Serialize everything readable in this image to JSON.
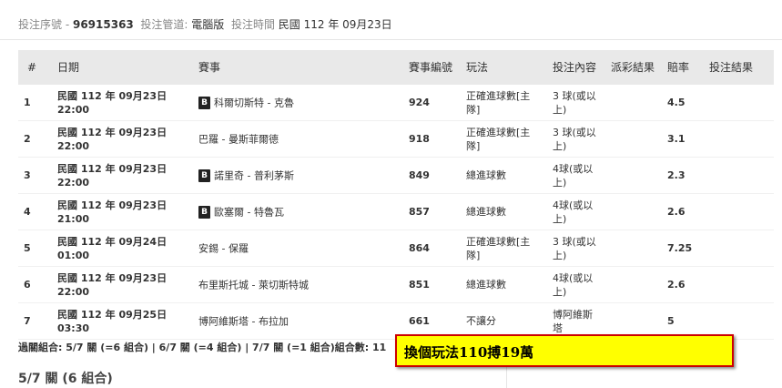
{
  "header": {
    "serial_label": "投注序號 -",
    "serial_value": "96915363",
    "channel_label": "投注管道:",
    "channel_value": "電腦版",
    "time_label": "投注時間",
    "time_value": "民國 112 年 09月23日"
  },
  "table": {
    "columns": [
      "#",
      "日期",
      "賽事",
      "賽事編號",
      "玩法",
      "投注內容",
      "派彩結果",
      "賠率",
      "投注結果"
    ],
    "rows": [
      {
        "idx": "1",
        "date_line1": "民國 112 年 09月23日",
        "date_line2": "22:00",
        "badge": "B",
        "match": "科爾切斯特 - 克魯",
        "no": "924",
        "play": "正確進球數[主隊]",
        "content": "3 球(或以上)",
        "payout": "",
        "odds": "4.5",
        "result": ""
      },
      {
        "idx": "2",
        "date_line1": "民國 112 年 09月23日",
        "date_line2": "22:00",
        "badge": "",
        "match": "巴羅 - 曼斯菲爾德",
        "no": "918",
        "play": "正確進球數[主隊]",
        "content": "3 球(或以上)",
        "payout": "",
        "odds": "3.1",
        "result": ""
      },
      {
        "idx": "3",
        "date_line1": "民國 112 年 09月23日",
        "date_line2": "22:00",
        "badge": "B",
        "match": "諾里奇 - 普利茅斯",
        "no": "849",
        "play": "總進球數",
        "content": "4球(或以上)",
        "payout": "",
        "odds": "2.3",
        "result": ""
      },
      {
        "idx": "4",
        "date_line1": "民國 112 年 09月23日",
        "date_line2": "21:00",
        "badge": "B",
        "match": "歐塞爾 - 特魯瓦",
        "no": "857",
        "play": "總進球數",
        "content": "4球(或以上)",
        "payout": "",
        "odds": "2.6",
        "result": ""
      },
      {
        "idx": "5",
        "date_line1": "民國 112 年 09月24日",
        "date_line2": "01:00",
        "badge": "",
        "match": "安錫 - 保羅",
        "no": "864",
        "play": "正確進球數[主隊]",
        "content": "3 球(或以上)",
        "payout": "",
        "odds": "7.25",
        "result": ""
      },
      {
        "idx": "6",
        "date_line1": "民國 112 年 09月23日",
        "date_line2": "22:00",
        "badge": "",
        "match": "布里斯托城 - 萊切斯特城",
        "no": "851",
        "play": "總進球數",
        "content": "4球(或以上)",
        "payout": "",
        "odds": "2.6",
        "result": ""
      },
      {
        "idx": "7",
        "date_line1": "民國 112 年 09月25日",
        "date_line2": "03:30",
        "badge": "",
        "match": "博阿維斯塔 - 布拉加",
        "no": "661",
        "play": "不讓分",
        "content": "博阿維斯塔",
        "payout": "",
        "odds": "5",
        "result": ""
      }
    ]
  },
  "summary": {
    "combo_text": "過關組合: 5/7 關 (=6 組合) | 6/7 關 (=4 組合) | 7/7 關 (=1 組合)組合數: 11",
    "section_title": "5/7 關 (6 組合)"
  },
  "note": {
    "text": "換個玩法110搏19萬",
    "background": "#ffff00",
    "border": "#cc0000"
  }
}
